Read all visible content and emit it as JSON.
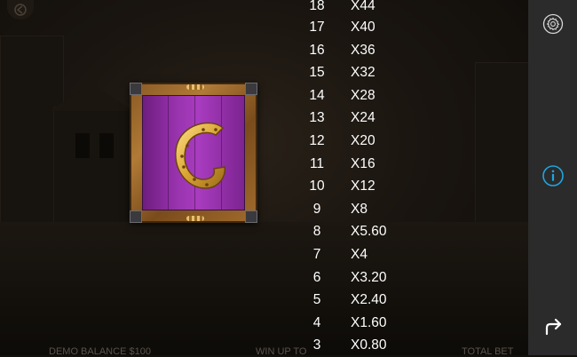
{
  "paytable": {
    "rows": [
      {
        "count": "18",
        "multiplier": "X44"
      },
      {
        "count": "17",
        "multiplier": "X40"
      },
      {
        "count": "16",
        "multiplier": "X36"
      },
      {
        "count": "15",
        "multiplier": "X32"
      },
      {
        "count": "14",
        "multiplier": "X28"
      },
      {
        "count": "13",
        "multiplier": "X24"
      },
      {
        "count": "12",
        "multiplier": "X20"
      },
      {
        "count": "11",
        "multiplier": "X16"
      },
      {
        "count": "10",
        "multiplier": "X12"
      },
      {
        "count": "9",
        "multiplier": "X8"
      },
      {
        "count": "8",
        "multiplier": "X5.60"
      },
      {
        "count": "7",
        "multiplier": "X4"
      },
      {
        "count": "6",
        "multiplier": "X3.20"
      },
      {
        "count": "5",
        "multiplier": "X2.40"
      },
      {
        "count": "4",
        "multiplier": "X1.60"
      },
      {
        "count": "3",
        "multiplier": "X0.80"
      }
    ]
  },
  "symbol": {
    "icon": "horseshoe-icon",
    "background_color": "#9a34b0",
    "frame_color": "#a06a2c"
  },
  "hud": {
    "balance_label": "DEMO BALANCE",
    "balance_value": "$100",
    "win_label": "WIN UP TO",
    "total_label": "TOTAL BET"
  },
  "sidebar": {
    "settings_icon": "gear-icon",
    "info_icon": "info-icon",
    "back_icon": "return-arrow-icon"
  },
  "colors": {
    "accent": "#1ea6e0",
    "panel": "#2b2b2b",
    "text": "#ffffff"
  }
}
